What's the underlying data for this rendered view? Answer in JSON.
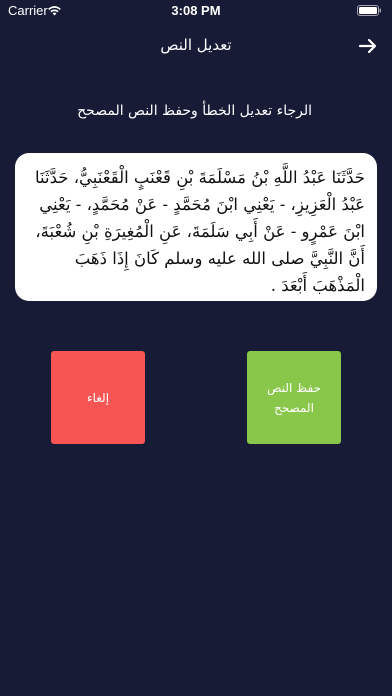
{
  "status_bar": {
    "carrier": "Carrier",
    "time": "3:08 PM",
    "icons": [
      "wifi-icon",
      "battery-icon"
    ]
  },
  "nav": {
    "title": "تعديل النص",
    "back_icon": "right-arrow-icon"
  },
  "instruction": "الرجاء تعديل الخطأ وحفظ النص المصحح",
  "editor": {
    "text": "حَدَّثَنَا عَبْدُ اللَّهِ بْنُ مَسْلَمَةَ بْنِ قَعْنَبٍ الْقَعْنَبِيُّ، حَدَّثَنَا عَبْدُ الْعَزِيزِ، - يَعْنِي ابْنَ مُحَمَّدٍ - عَنْ مُحَمَّدٍ، - يَعْنِي ابْنَ عَمْرٍو - عَنْ أَبِي سَلَمَةَ، عَنِ الْمُغِيرَةِ بْنِ شُعْبَةَ، أَنَّ النَّبِيَّ صلى الله عليه وسلم كَانَ إِذَا ذَهَبَ الْمَذْهَبَ أَبْعَدَ ."
  },
  "buttons": {
    "cancel": "إلغاء",
    "save": "حفظ النص المصحح"
  },
  "colors": {
    "background": "#171b36",
    "cancel": "#f65554",
    "save": "#89c74a",
    "editor_bg": "#ffffff"
  }
}
